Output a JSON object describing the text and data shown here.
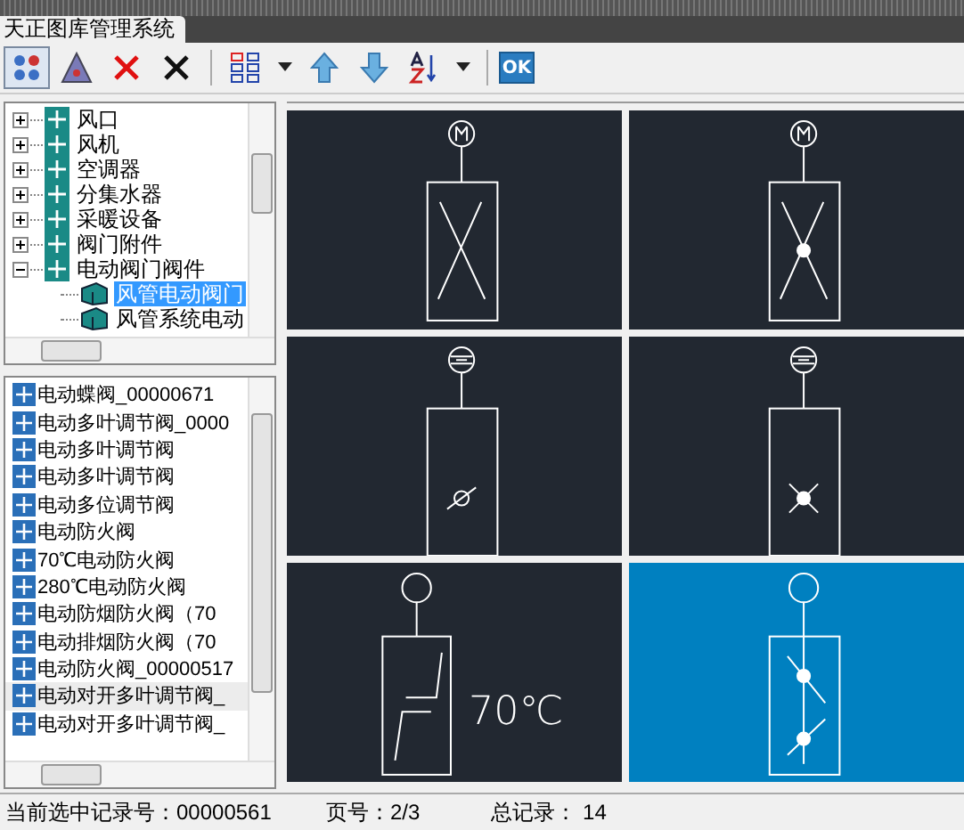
{
  "window": {
    "title": "天正图库管理系统"
  },
  "toolbar": [
    {
      "kind": "view-icons",
      "pressed": true
    },
    {
      "kind": "view-triangles",
      "pressed": false
    },
    {
      "kind": "delete-red",
      "pressed": false
    },
    {
      "kind": "delete-black",
      "pressed": false
    },
    {
      "kind": "separator"
    },
    {
      "kind": "layout",
      "pressed": false
    },
    {
      "kind": "dropdown",
      "pressed": false
    },
    {
      "kind": "move-up",
      "pressed": false
    },
    {
      "kind": "move-down",
      "pressed": false
    },
    {
      "kind": "sort",
      "pressed": false
    },
    {
      "kind": "dropdown",
      "pressed": false
    },
    {
      "kind": "separator"
    },
    {
      "kind": "ok",
      "pressed": false,
      "label": "OK"
    }
  ],
  "tree": {
    "items": [
      {
        "label": "风口",
        "expanded": false
      },
      {
        "label": "风机",
        "expanded": false
      },
      {
        "label": "空调器",
        "expanded": false
      },
      {
        "label": "分集水器",
        "expanded": false
      },
      {
        "label": "采暖设备",
        "expanded": false
      },
      {
        "label": "阀门附件",
        "expanded": false
      },
      {
        "label": "电动阀门阀件",
        "expanded": true,
        "children": [
          {
            "label": "风管电动阀门",
            "selected": true
          },
          {
            "label": "风管系统电动",
            "selected": false
          }
        ]
      }
    ]
  },
  "list": {
    "items": [
      {
        "label": "电动蝶阀_00000671",
        "selected": false
      },
      {
        "label": "电动多叶调节阀_0000",
        "selected": false
      },
      {
        "label": "电动多叶调节阀",
        "selected": false
      },
      {
        "label": "电动多叶调节阀",
        "selected": false
      },
      {
        "label": "电动多位调节阀",
        "selected": false
      },
      {
        "label": "电动防火阀",
        "selected": false
      },
      {
        "label": "70℃电动防火阀",
        "selected": false
      },
      {
        "label": "280℃电动防火阀",
        "selected": false
      },
      {
        "label": "电动防烟防火阀（70",
        "selected": false
      },
      {
        "label": "电动排烟防火阀（70",
        "selected": false
      },
      {
        "label": "电动防火阀_00000517",
        "selected": false
      },
      {
        "label": "电动对开多叶调节阀_",
        "selected": true
      },
      {
        "label": "电动对开多叶调节阀_",
        "selected": false
      }
    ]
  },
  "symbols": [
    {
      "kind": "motor-cross",
      "selected": false
    },
    {
      "kind": "motor-cross-dot",
      "selected": false
    },
    {
      "kind": "solenoid-slash",
      "selected": false
    },
    {
      "kind": "solenoid-cross-dot",
      "selected": false
    },
    {
      "kind": "fire-damper",
      "selected": false,
      "label": "70℃"
    },
    {
      "kind": "double-dot",
      "selected": true
    }
  ],
  "status_bar": {
    "record": "当前选中记录号：00000561",
    "page": "页号：2/3",
    "total": "总记录： 14"
  }
}
